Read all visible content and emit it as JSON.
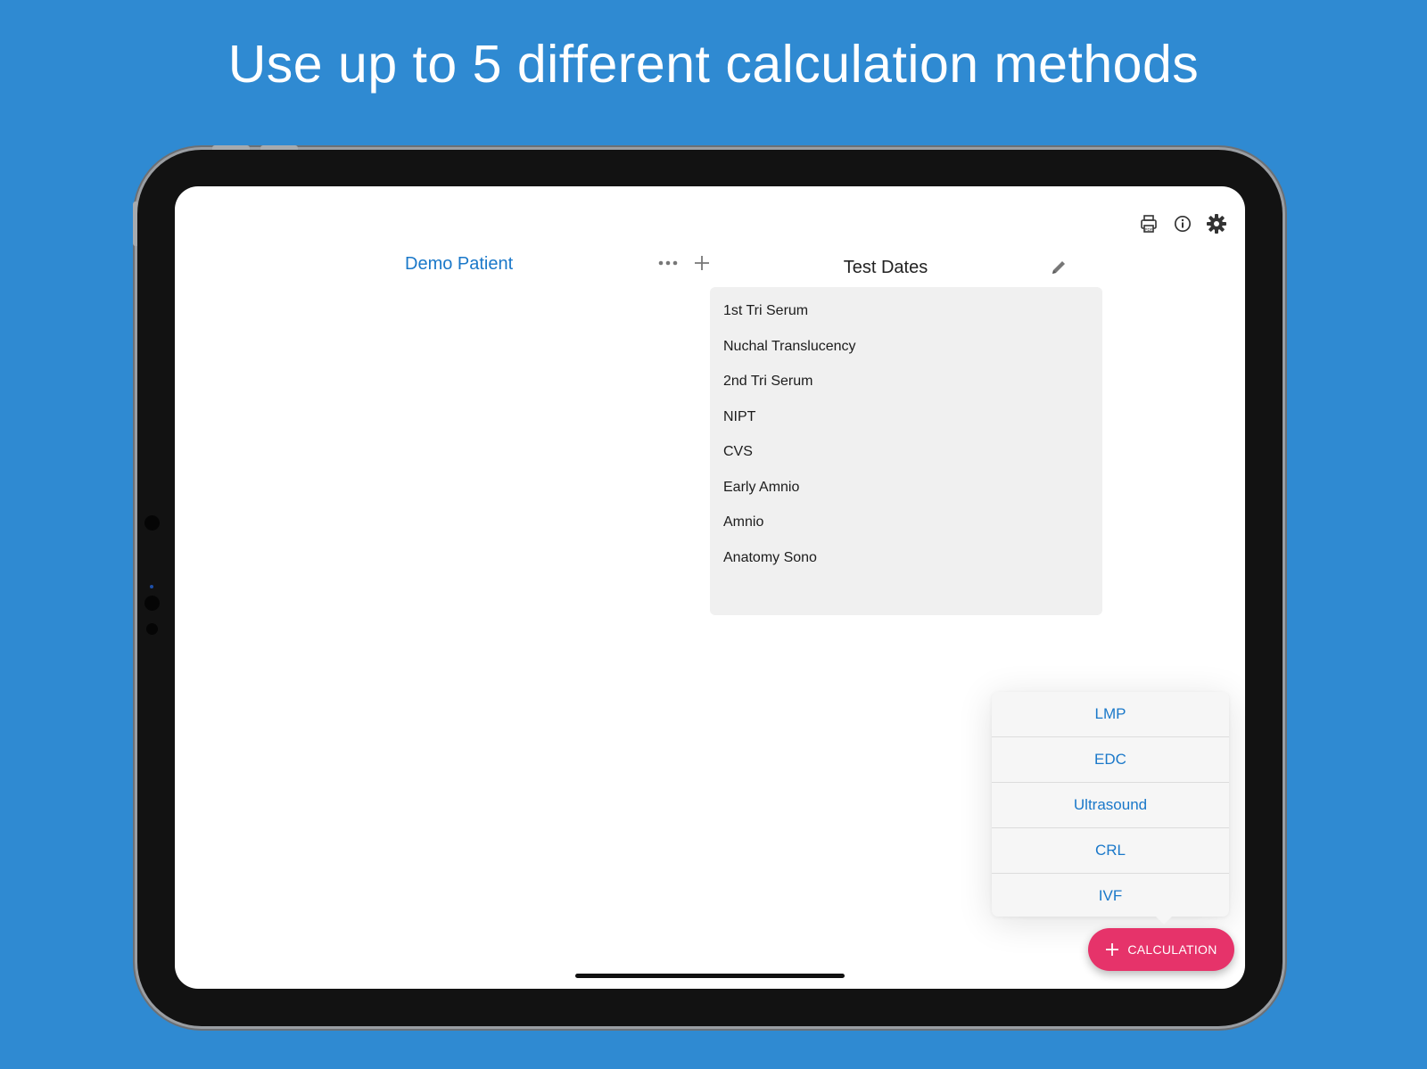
{
  "headline": "Use up to 5 different calculation methods",
  "app": {
    "toolbar": {
      "icons": [
        "pdf-print-icon",
        "info-icon",
        "gear-icon"
      ]
    },
    "patient": {
      "name": "Demo Patient",
      "action_icons": [
        "more-dots-icon",
        "plus-icon"
      ]
    },
    "test_dates": {
      "title": "Test Dates",
      "edit_icon": "pencil-icon",
      "items": [
        "1st Tri Serum",
        "Nuchal Translucency",
        "2nd Tri Serum",
        "NIPT",
        "CVS",
        "Early Amnio",
        "Amnio",
        "Anatomy Sono"
      ]
    },
    "calc_menu": {
      "items": [
        "LMP",
        "EDC",
        "Ultrasound",
        "CRL",
        "IVF"
      ]
    },
    "fab": {
      "label": "CALCULATION",
      "icon": "plus-icon"
    }
  },
  "colors": {
    "background": "#2f8ad2",
    "accent_blue": "#1a78c9",
    "fab_pink": "#e6336a",
    "panel_gray": "#f0f0f0"
  }
}
